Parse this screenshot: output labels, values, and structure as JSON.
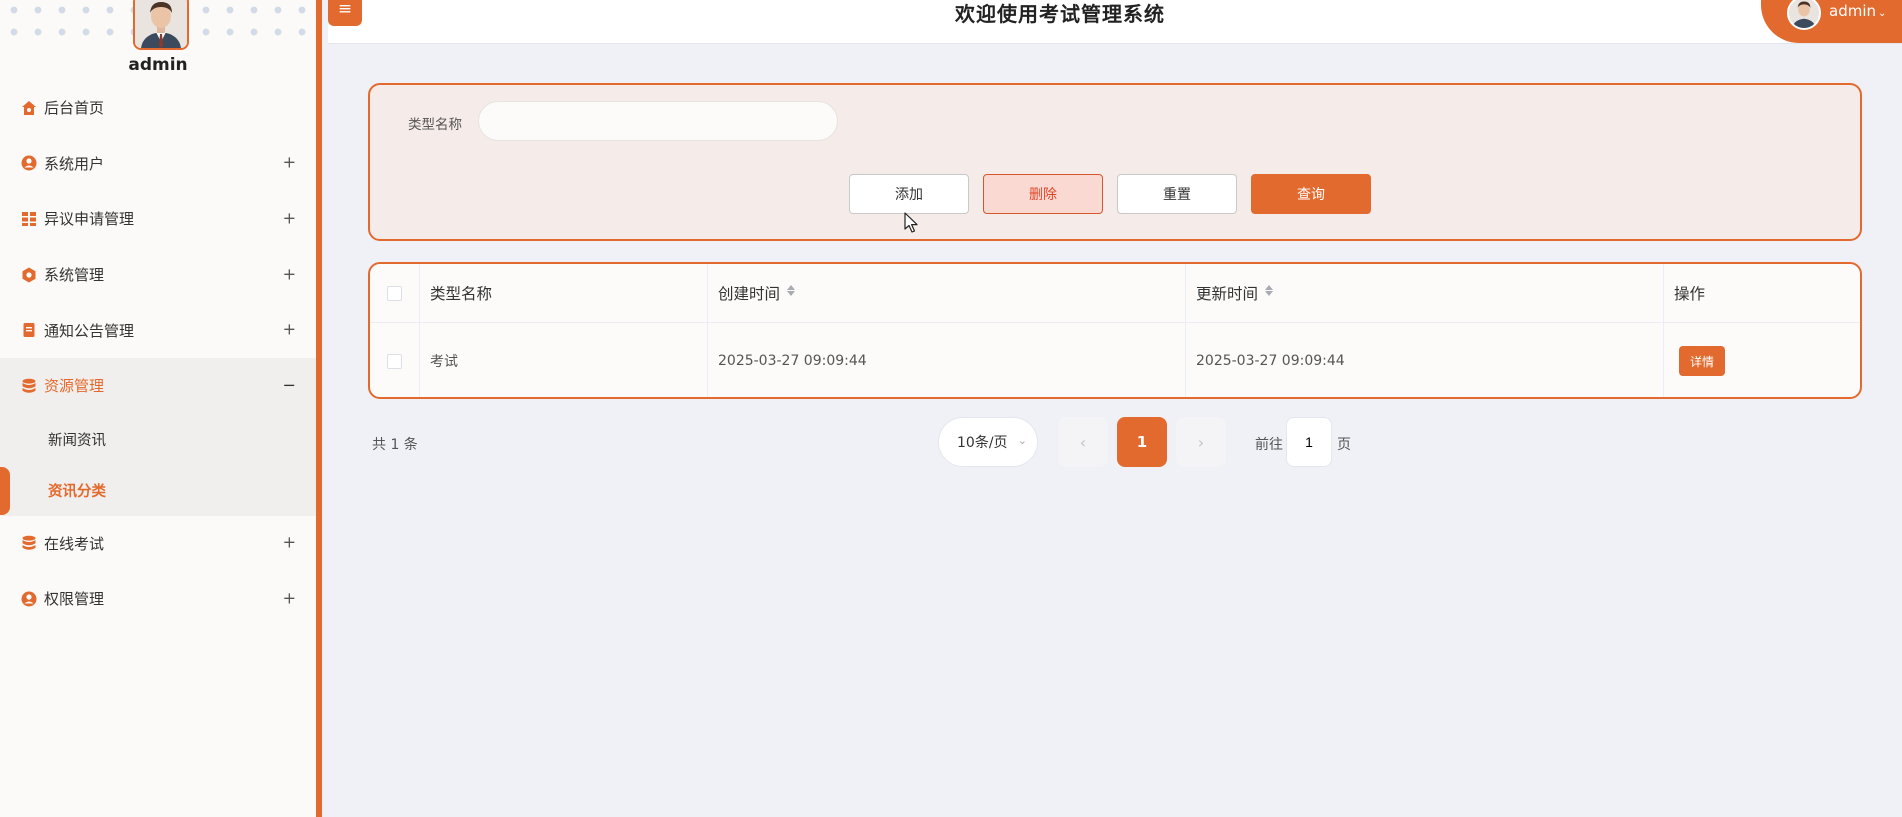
{
  "app": {
    "title": "欢迎使用考试管理系统"
  },
  "header": {
    "menu_icon": "hamburger-icon",
    "user_name": "admin"
  },
  "sidebar": {
    "username": "admin",
    "menu": [
      {
        "label": "后台首页",
        "icon": "home-icon",
        "expandable": false
      },
      {
        "label": "系统用户",
        "icon": "user-icon",
        "expandable": true
      },
      {
        "label": "异议申请管理",
        "icon": "grid-icon",
        "expandable": true
      },
      {
        "label": "系统管理",
        "icon": "settings-icon",
        "expandable": true
      },
      {
        "label": "通知公告管理",
        "icon": "document-icon",
        "expandable": true
      },
      {
        "label": "资源管理",
        "icon": "database-icon",
        "expandable": true,
        "expanded": true,
        "children": [
          {
            "label": "新闻资讯"
          },
          {
            "label": "资讯分类",
            "current": true
          }
        ]
      },
      {
        "label": "在线考试",
        "icon": "database-icon",
        "expandable": true
      },
      {
        "label": "权限管理",
        "icon": "user-icon",
        "expandable": true
      }
    ]
  },
  "search": {
    "label": "类型名称",
    "value": "",
    "placeholder": "",
    "buttons": {
      "add": "添加",
      "delete": "删除",
      "reset": "重置",
      "query": "查询"
    }
  },
  "table": {
    "columns": {
      "name": "类型名称",
      "created": "创建时间",
      "updated": "更新时间",
      "op": "操作"
    },
    "rows": [
      {
        "name": "考试",
        "created": "2025-03-27 09:09:44",
        "updated": "2025-03-27 09:09:44",
        "action": "详情"
      }
    ]
  },
  "pagination": {
    "total_text": "共 1 条",
    "page_size": "10条/页",
    "current_page": "1",
    "goto_label": "前往",
    "goto_value": "1",
    "goto_suffix": "页"
  },
  "colors": {
    "accent": "#e36a2e",
    "page_bg": "#f0f1f6",
    "panel_bg": "#f5ebe8"
  }
}
